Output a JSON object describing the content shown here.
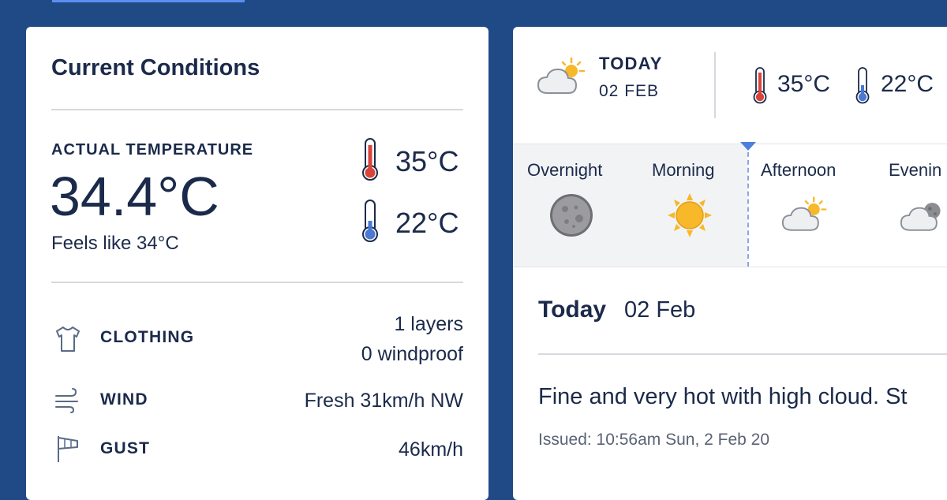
{
  "current": {
    "title": "Current Conditions",
    "actual_label": "ACTUAL TEMPERATURE",
    "actual_value": "34.4°C",
    "feels_like": "Feels like 34°C",
    "max_temp": "35°C",
    "min_temp": "22°C",
    "clothing_label": "CLOTHING",
    "clothing_layers": "1 layers",
    "clothing_windproof": "0 windproof",
    "wind_label": "WIND",
    "wind_value": "Fresh 31km/h NW",
    "gust_label": "GUST",
    "gust_value": "46km/h"
  },
  "forecast": {
    "today_label": "TODAY",
    "today_date": "02 FEB",
    "max_temp": "35°C",
    "min_temp": "22°C",
    "periods": [
      {
        "label": "Overnight",
        "icon": "moon-icon"
      },
      {
        "label": "Morning",
        "icon": "sun-icon"
      },
      {
        "label": "Afternoon",
        "icon": "partly-cloudy-icon"
      },
      {
        "label": "Evenin",
        "icon": "cloudy-night-icon"
      }
    ],
    "detail_title": "Today",
    "detail_date": "02 Feb",
    "summary": "Fine and very hot with high cloud. St",
    "issued": "Issued: 10:56am Sun, 2 Feb 20"
  },
  "colors": {
    "background": "#1f4a86",
    "hot": "#d9443a",
    "cold": "#4a78d4",
    "sun": "#f7b829",
    "accent": "#5b8ef0"
  }
}
